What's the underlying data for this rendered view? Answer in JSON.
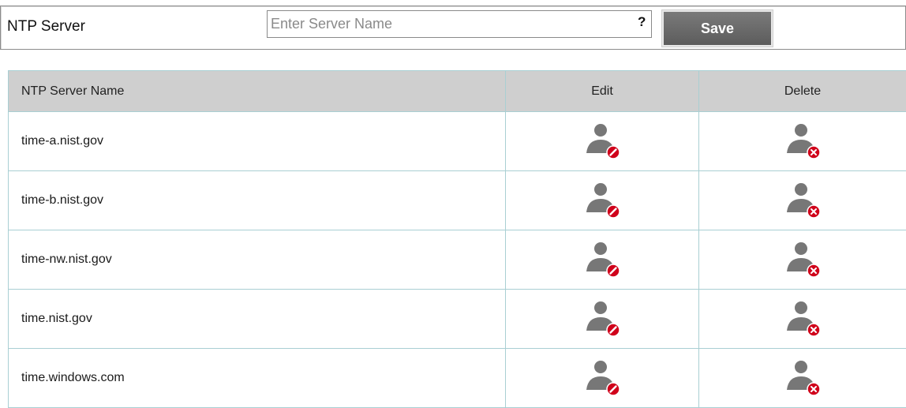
{
  "form": {
    "label": "NTP Server",
    "input_value": "",
    "input_placeholder": "Enter Server Name",
    "help": "?",
    "save_label": "Save"
  },
  "table": {
    "columns": [
      "NTP Server Name",
      "Edit",
      "Delete"
    ],
    "rows": [
      {
        "name": "time-a.nist.gov"
      },
      {
        "name": "time-b.nist.gov"
      },
      {
        "name": "time-nw.nist.gov"
      },
      {
        "name": "time.nist.gov"
      },
      {
        "name": "time.windows.com"
      }
    ]
  },
  "icons": {
    "edit": "edit-user-icon",
    "delete": "delete-user-icon"
  },
  "colors": {
    "user_icon": "#777777",
    "badge": "#d0021b",
    "header_bg": "#cfcfcf",
    "grid": "#a9cfd3",
    "save_button": "#666666"
  }
}
